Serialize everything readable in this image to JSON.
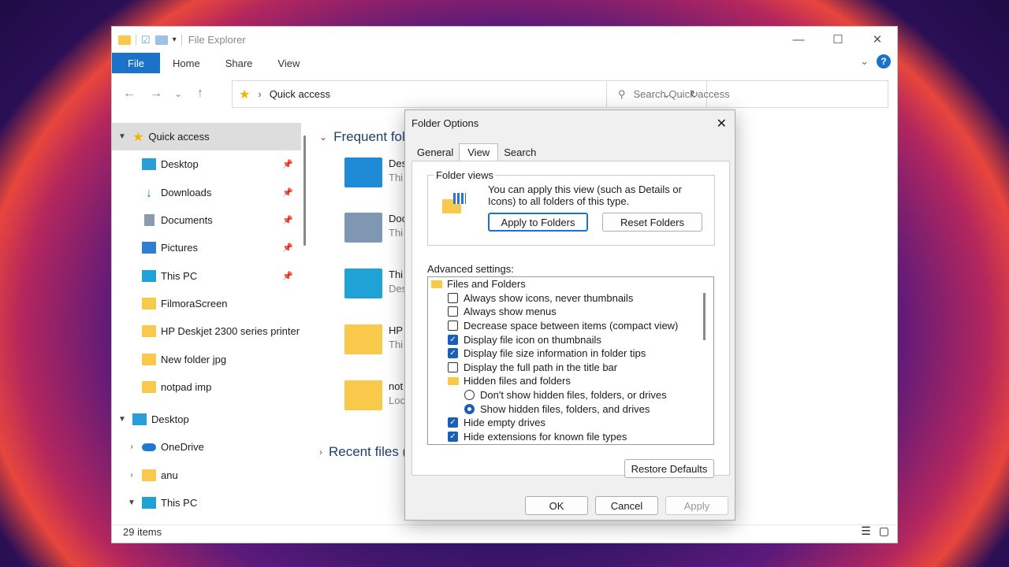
{
  "window": {
    "title": "File Explorer",
    "ribbon_tabs": [
      "File",
      "Home",
      "Share",
      "View"
    ],
    "minimize": "—",
    "maximize": "☐",
    "close": "✕"
  },
  "nav": {
    "back": "←",
    "forward": "→",
    "recent": "⌄",
    "up": "↑",
    "address": "Quick access",
    "search_placeholder": "Search Quick access"
  },
  "sidebar": {
    "items": [
      {
        "label": "Quick access",
        "pinned": false
      },
      {
        "label": "Desktop",
        "pinned": true
      },
      {
        "label": "Downloads",
        "pinned": true
      },
      {
        "label": "Documents",
        "pinned": true
      },
      {
        "label": "Pictures",
        "pinned": true
      },
      {
        "label": "This PC",
        "pinned": true
      },
      {
        "label": "FilmoraScreen",
        "pinned": false
      },
      {
        "label": "HP Deskjet 2300 series printer",
        "pinned": false
      },
      {
        "label": "New folder jpg",
        "pinned": false
      },
      {
        "label": "notpad imp",
        "pinned": false
      },
      {
        "label": "Desktop",
        "pinned": false
      },
      {
        "label": "OneDrive",
        "pinned": false
      },
      {
        "label": "anu",
        "pinned": false
      },
      {
        "label": "This PC",
        "pinned": false
      }
    ]
  },
  "main": {
    "frequent_title": "Frequent fold",
    "recent_title": "Recent files (",
    "items": [
      {
        "t1": "Des",
        "t2": "Thi"
      },
      {
        "t1": "Doc",
        "t2": "Thi"
      },
      {
        "t1": "Thi",
        "t2": "Des"
      },
      {
        "t1": "HP",
        "t2": "Thi"
      },
      {
        "t1": "not",
        "t2": "Loc"
      }
    ]
  },
  "status": {
    "count": "29 items"
  },
  "dialog": {
    "title": "Folder Options",
    "tabs": [
      "General",
      "View",
      "Search"
    ],
    "folder_views_label": "Folder views",
    "folder_views_desc": "You can apply this view (such as Details or Icons) to all folders of this type.",
    "apply_to_folders": "Apply to Folders",
    "reset_folders": "Reset Folders",
    "advanced_label": "Advanced settings:",
    "settings": [
      {
        "type": "folder",
        "label": "Files and Folders",
        "indent": 0
      },
      {
        "type": "check",
        "label": "Always show icons, never thumbnails",
        "checked": false,
        "indent": 1
      },
      {
        "type": "check",
        "label": "Always show menus",
        "checked": false,
        "indent": 1
      },
      {
        "type": "check",
        "label": "Decrease space between items (compact view)",
        "checked": false,
        "indent": 1
      },
      {
        "type": "check",
        "label": "Display file icon on thumbnails",
        "checked": true,
        "indent": 1
      },
      {
        "type": "check",
        "label": "Display file size information in folder tips",
        "checked": true,
        "indent": 1
      },
      {
        "type": "check",
        "label": "Display the full path in the title bar",
        "checked": false,
        "indent": 1
      },
      {
        "type": "folder",
        "label": "Hidden files and folders",
        "indent": 1
      },
      {
        "type": "radio",
        "label": "Don't show hidden files, folders, or drives",
        "checked": false,
        "indent": 2
      },
      {
        "type": "radio",
        "label": "Show hidden files, folders, and drives",
        "checked": true,
        "indent": 2
      },
      {
        "type": "check",
        "label": "Hide empty drives",
        "checked": true,
        "indent": 1
      },
      {
        "type": "check",
        "label": "Hide extensions for known file types",
        "checked": true,
        "indent": 1
      }
    ],
    "restore_defaults": "Restore Defaults",
    "ok": "OK",
    "cancel": "Cancel",
    "apply": "Apply"
  }
}
